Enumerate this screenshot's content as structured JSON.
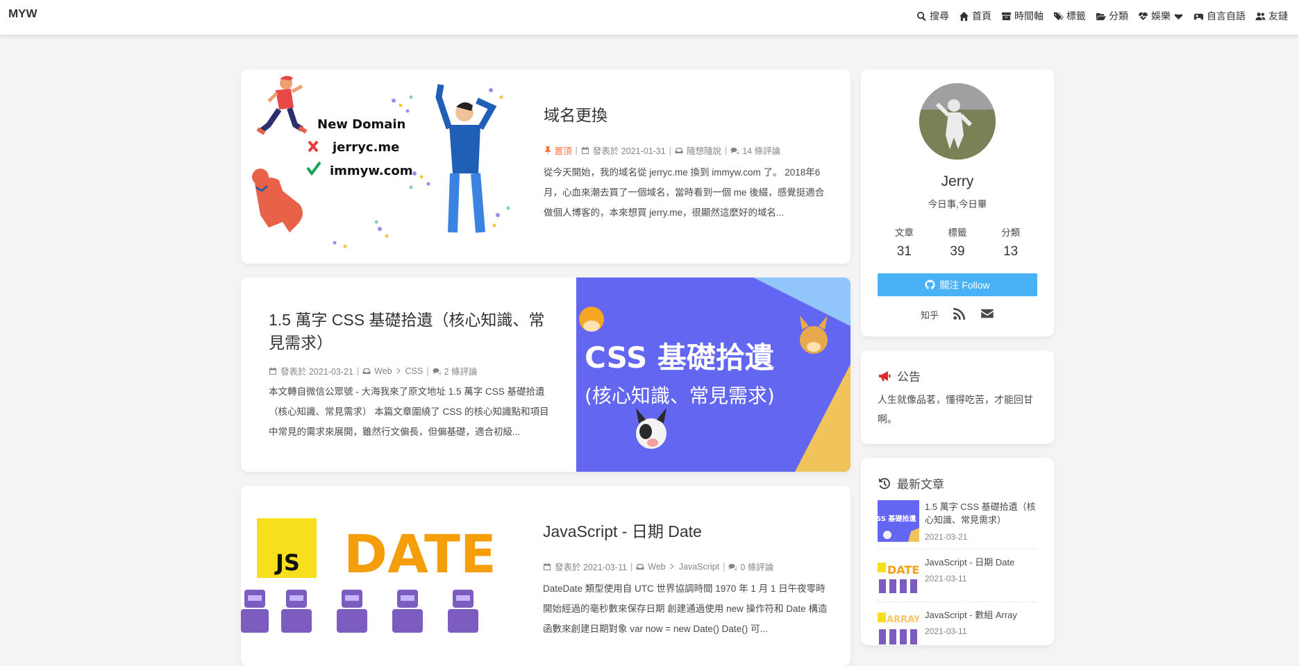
{
  "header": {
    "brand": "MYW",
    "menu": [
      {
        "label": "搜尋",
        "icon": "search-icon"
      },
      {
        "label": "首頁",
        "icon": "home-icon"
      },
      {
        "label": "時間軸",
        "icon": "archive-icon"
      },
      {
        "label": "標籤",
        "icon": "tags-icon"
      },
      {
        "label": "分類",
        "icon": "folder-open-icon"
      },
      {
        "label": "娛樂",
        "icon": "heartbeat-icon"
      },
      {
        "label": "自言自語",
        "icon": "gamepad-icon"
      },
      {
        "label": "友鏈",
        "icon": "users-icon"
      }
    ]
  },
  "posts": [
    {
      "title": "域名更換",
      "pinned": "置頂",
      "date": "發表於 2021-01-31",
      "category": "隨想隨說",
      "comments": "14 條評論",
      "excerpt": "從今天開始，我的域名從 jerryc.me 換到 immyw.com 了。 2018年6月，心血來潮去買了一個域名，當時看到一個 me 後綴，感覺挺適合做個人博客的，本來想買 jerry.me，很顯然這麼好的域名...",
      "cover": {
        "line1": "New Domain",
        "line2": "jerryc.me",
        "line3": "immyw.com"
      }
    },
    {
      "title": "1.5 萬字 CSS 基礎拾遺（核心知識、常見需求）",
      "date": "發表於 2021-03-21",
      "category": "Web",
      "subcategory": "CSS",
      "comments": "2 條評論",
      "excerpt": "本文轉自微信公眾號 - 大海我來了原文地址 1.5 萬字 CSS 基礎拾遺（核心知識、常見需求） 本篇文章圍繞了 CSS 的核心知識點和項目中常見的需求來展開，雖然行文偏長，但偏基礎，適合初級...",
      "cover": {
        "line1": "CSS 基礎拾遺",
        "line2": "(核心知識、常見需求)"
      }
    },
    {
      "title": "JavaScript - 日期 Date",
      "date": "發表於 2021-03-11",
      "category": "Web",
      "subcategory": "JavaScript",
      "comments": "0 條評論",
      "excerpt": "DateDate 類型使用自 UTC 世界協調時間 1970 年 1 月 1 日午夜零時開始經過的毫秒數來保存日期 創建通過使用 new 操作符和 Date 構造函數來創建日期對象 var now = new Date() Date() 可...",
      "cover": {
        "badge": "JS",
        "word": "DATE"
      }
    }
  ],
  "author": {
    "name": "Jerry",
    "description": "今日事,今日畢",
    "stats": [
      {
        "label": "文章",
        "value": "31"
      },
      {
        "label": "標籤",
        "value": "39"
      },
      {
        "label": "分類",
        "value": "13"
      }
    ],
    "follow_label": "關注 Follow",
    "social_zhihu": "知乎"
  },
  "announcement": {
    "title": "公告",
    "text": "人生就像品茗，懂得吃苦，才能回甘啊。"
  },
  "recent": {
    "title": "最新文章",
    "items": [
      {
        "title": "1.5 萬字 CSS 基礎拾遺（核心知識、常見需求）",
        "date": "2021-03-21",
        "thumb_text": "SS 基礎拾遺"
      },
      {
        "title": "JavaScript - 日期 Date",
        "date": "2021-03-11",
        "thumb_text": "DATE"
      },
      {
        "title": "JavaScript - 數組 Array",
        "date": "2021-03-11",
        "thumb_text": "ARRAY"
      }
    ]
  },
  "colors": {
    "accent": "#49b1f5",
    "pin": "#ff7242",
    "css_cover": "#6366f1",
    "js_yellow": "#f7df1e",
    "date_orange": "#f59e0b"
  }
}
